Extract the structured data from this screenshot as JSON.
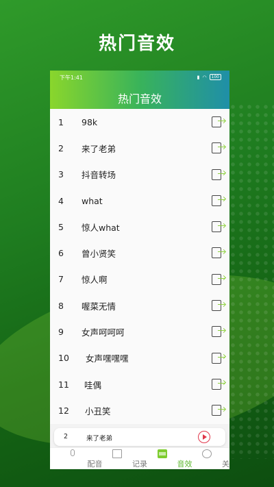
{
  "promo": {
    "title": "热门音效"
  },
  "status_bar": {
    "time": "下午1:41",
    "battery": "100"
  },
  "app": {
    "title": "热门音效"
  },
  "sounds": [
    {
      "num": "1",
      "name": "98k"
    },
    {
      "num": "2",
      "name": "来了老弟"
    },
    {
      "num": "3",
      "name": "抖音转场"
    },
    {
      "num": "4",
      "name": "what"
    },
    {
      "num": "5",
      "name": "惊人what"
    },
    {
      "num": "6",
      "name": "曾小贤笑"
    },
    {
      "num": "7",
      "name": "惊人啊"
    },
    {
      "num": "8",
      "name": "喔菜无情"
    },
    {
      "num": "9",
      "name": "女声呵呵呵"
    },
    {
      "num": "10",
      "name": "女声嘿嘿嘿"
    },
    {
      "num": "11",
      "name": "哇偶"
    },
    {
      "num": "12",
      "name": "小丑笑"
    }
  ],
  "player": {
    "num": "2",
    "name": "来了老弟",
    "icon": "play-icon"
  },
  "tabs": [
    {
      "label": "配音",
      "icon": "mic-icon"
    },
    {
      "label": "记录",
      "icon": "folder-icon"
    },
    {
      "label": "音效",
      "icon": "film-icon",
      "active": true
    },
    {
      "label": "关于",
      "icon": "user-icon"
    }
  ],
  "colors": {
    "accent": "#5cb82e",
    "play": "#e0364a",
    "background": "#1f7d20"
  }
}
